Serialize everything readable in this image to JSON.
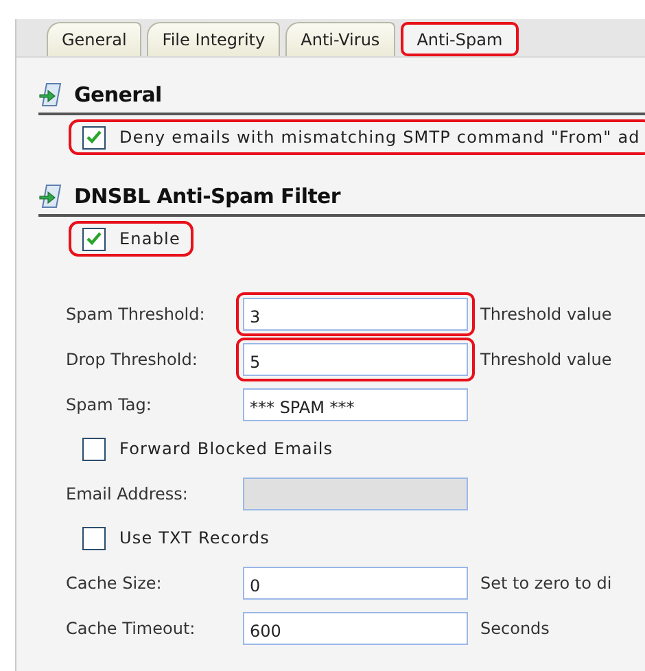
{
  "tabs": [
    {
      "label": "General",
      "selected": false,
      "highlighted": false
    },
    {
      "label": "File Integrity",
      "selected": false,
      "highlighted": false
    },
    {
      "label": "Anti-Virus",
      "selected": false,
      "highlighted": false
    },
    {
      "label": "Anti-Spam",
      "selected": true,
      "highlighted": true
    }
  ],
  "sections": [
    {
      "title": "General",
      "rows": [
        {
          "kind": "checkbox",
          "label": "Deny emails with mismatching SMTP command \"From\" ad",
          "checked": true,
          "highlighted": true
        }
      ]
    },
    {
      "title": "DNSBL Anti-Spam Filter",
      "rows": [
        {
          "kind": "checkbox",
          "label": "Enable",
          "checked": true,
          "highlighted": true
        },
        {
          "kind": "spacer"
        },
        {
          "kind": "field",
          "label": "Spam Threshold:",
          "value": "3",
          "note": "Threshold value",
          "highlighted": true,
          "disabled": false
        },
        {
          "kind": "field",
          "label": "Drop Threshold:",
          "value": "5",
          "note": "Threshold value",
          "highlighted": true,
          "disabled": false
        },
        {
          "kind": "field",
          "label": "Spam Tag:",
          "value": "*** SPAM ***",
          "highlighted": false,
          "disabled": false
        },
        {
          "kind": "checkbox",
          "label": "Forward Blocked Emails",
          "checked": false,
          "highlighted": false
        },
        {
          "kind": "field",
          "label": "Email Address:",
          "highlighted": false,
          "disabled": true
        },
        {
          "kind": "checkbox",
          "label": "Use TXT Records",
          "checked": false,
          "highlighted": false
        },
        {
          "kind": "field",
          "label": "Cache Size:",
          "value": "0",
          "note": "Set to zero to di",
          "highlighted": false,
          "disabled": false
        },
        {
          "kind": "field",
          "label": "Cache Timeout:",
          "value": "600",
          "note": "Seconds",
          "highlighted": false,
          "disabled": false
        }
      ]
    }
  ]
}
